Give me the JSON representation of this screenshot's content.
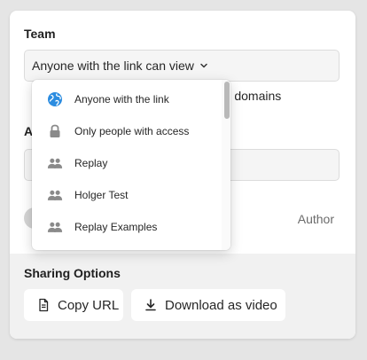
{
  "team": {
    "label": "Team",
    "selected": "Anyone with the link can view",
    "domains_note": "n 3 domains"
  },
  "hidden_section": {
    "label": "A",
    "author_label": "Author"
  },
  "dropdown": {
    "options": [
      {
        "label": "Anyone with the link",
        "icon": "globe-icon",
        "color": "#2b8ce0"
      },
      {
        "label": "Only people with access",
        "icon": "lock-icon",
        "color": "#8a8a8a"
      },
      {
        "label": "Replay",
        "icon": "people-icon",
        "color": "#8a8a8a"
      },
      {
        "label": "Holger Test",
        "icon": "people-icon",
        "color": "#8a8a8a"
      },
      {
        "label": "Replay Examples",
        "icon": "people-icon",
        "color": "#8a8a8a"
      }
    ]
  },
  "sharing": {
    "title": "Sharing Options",
    "copy_label": "Copy URL",
    "download_label": "Download as video"
  }
}
